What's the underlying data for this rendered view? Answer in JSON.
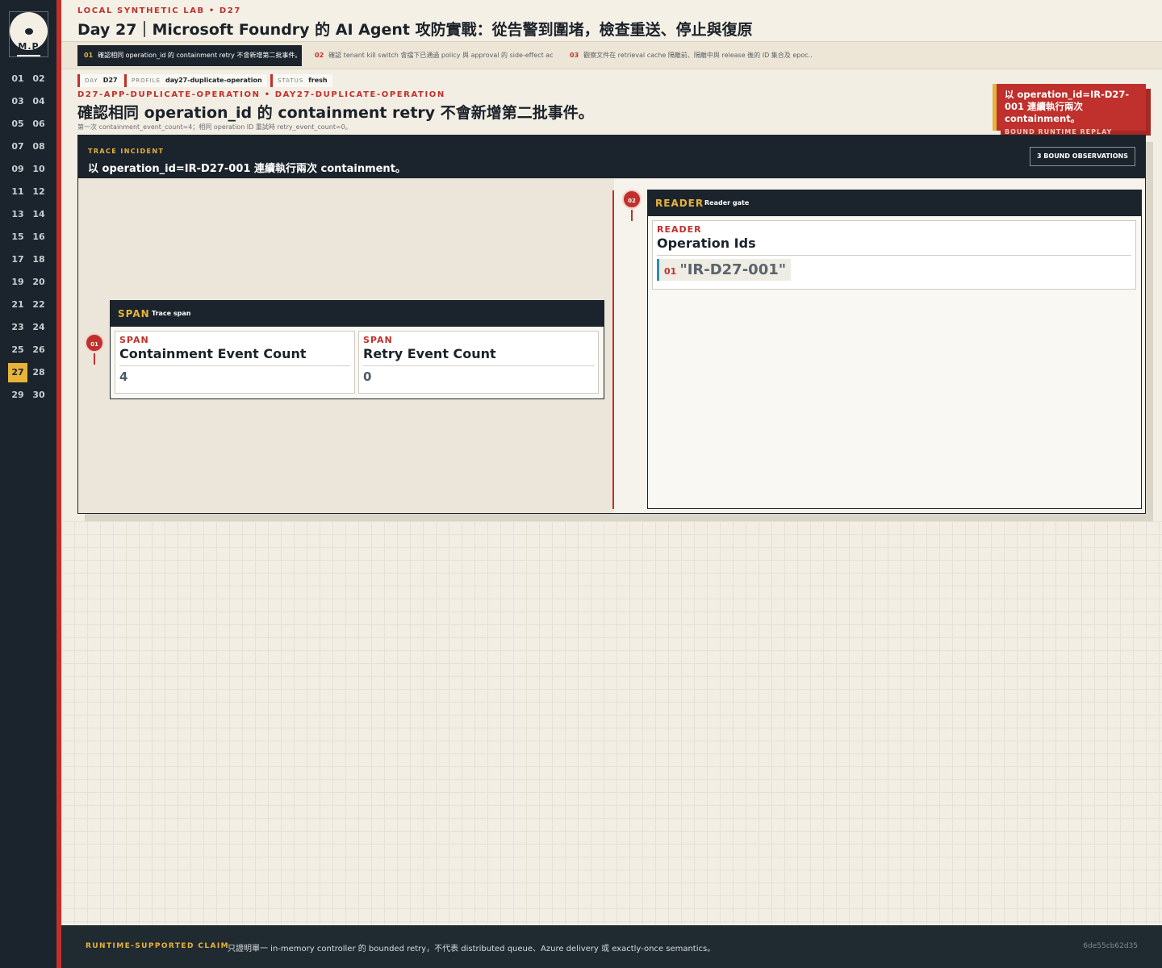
{
  "brand": {
    "mark": "M.P"
  },
  "days": [
    "01",
    "02",
    "03",
    "04",
    "05",
    "06",
    "07",
    "08",
    "09",
    "10",
    "11",
    "12",
    "13",
    "14",
    "15",
    "16",
    "17",
    "18",
    "19",
    "20",
    "21",
    "22",
    "23",
    "24",
    "25",
    "26",
    "27",
    "28",
    "29",
    "30"
  ],
  "active_day": "27",
  "header": {
    "lab": "LOCAL SYNTHETIC LAB  •  D27",
    "title": "Day 27｜Microsoft Foundry 的 AI Agent 攻防實戰：從告警到圍堵，檢查重送、停止與復原"
  },
  "tabs": [
    {
      "num": "01",
      "label": "確認相同 operation_id 的 containment retry 不會新增第二批事件。"
    },
    {
      "num": "02",
      "label": "確認 tenant kill switch 會擋下已通過 policy 與 approval 的 side-effect acti…"
    },
    {
      "num": "03",
      "label": "觀察文件在 retrieval cache 隔離前、隔離中與 release 後的 ID 集合及 epoc…"
    }
  ],
  "meta": [
    {
      "key": "DAY",
      "value": "D27"
    },
    {
      "key": "PROFILE",
      "value": "day27-duplicate-operation"
    },
    {
      "key": "STATUS",
      "value": "fresh"
    }
  ],
  "case": {
    "id": "D27-APP-DUPLICATE-OPERATION  •  DAY27-DUPLICATE-OPERATION",
    "title": "確認相同 operation_id 的 containment retry 不會新增第二批事件。",
    "subtitle": "第一次 containment_event_count=4；相同 operation ID 重試時 retry_event_count=0。"
  },
  "replay": {
    "title": "以 operation_id=IR-D27-001 連續執行兩次 containment。",
    "label": "BOUND RUNTIME REPLAY"
  },
  "incident": {
    "label": "TRACE INCIDENT",
    "title": "以 operation_id=IR-D27-001 連續執行兩次 containment。",
    "observations": "3 BOUND OBSERVATIONS"
  },
  "span": {
    "pin": "01",
    "kind": "SPAN",
    "subtitle": "Trace span",
    "cells": [
      {
        "label": "SPAN",
        "name": "Containment Event Count",
        "value": "4"
      },
      {
        "label": "SPAN",
        "name": "Retry Event Count",
        "value": "0"
      }
    ]
  },
  "reader": {
    "pin": "02",
    "kind": "READER",
    "subtitle": "Reader gate",
    "cell": {
      "label": "READER",
      "name": "Operation Ids",
      "items": [
        {
          "num": "01",
          "value": "\"IR-D27-001\""
        }
      ]
    }
  },
  "footer": {
    "label": "RUNTIME-SUPPORTED CLAIM",
    "text": "只證明單一 in-memory controller 的 bounded retry，不代表 distributed queue、Azure delivery 或 exactly-once semantics。",
    "hash": "6de55cb62d35"
  }
}
